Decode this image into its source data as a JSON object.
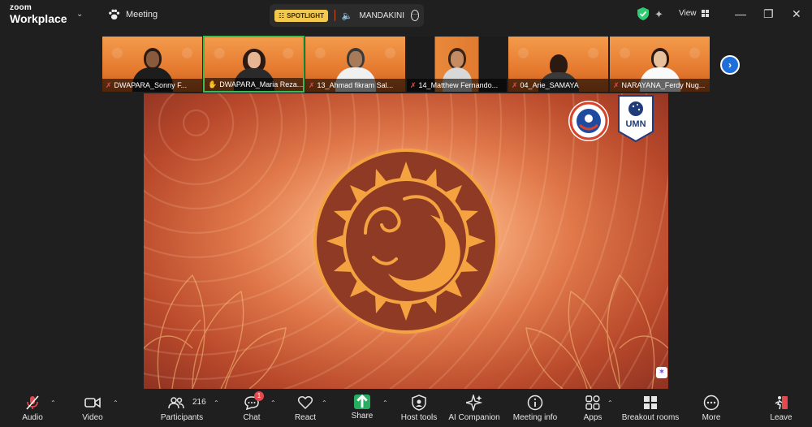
{
  "app": {
    "brand_line1": "zoom",
    "brand_line2": "Workplace",
    "meeting_tab": "Meeting"
  },
  "spotlight": {
    "badge": "SPOTLIGHT",
    "name": "MANDAKINI"
  },
  "view_label": "View",
  "participants_strip": [
    {
      "name": "DWAPARA_Sonny F..."
    },
    {
      "name": "DWAPARA_Maria Reza..."
    },
    {
      "name": "13_Ahmad fikram Sal..."
    },
    {
      "name": "14_Matthew Fernando..."
    },
    {
      "name": "04_Arie_SAMAYA"
    },
    {
      "name": "NARAYANA_Ferdy Nug..."
    }
  ],
  "main_screen": {
    "logo_right_text": "UMN"
  },
  "toolbar": {
    "audio": "Audio",
    "video": "Video",
    "participants": "Participants",
    "participants_count": "216",
    "chat": "Chat",
    "chat_badge": "1",
    "react": "React",
    "share": "Share",
    "host_tools": "Host tools",
    "ai_companion": "AI Companion",
    "meeting_info": "Meeting info",
    "apps": "Apps",
    "breakout_rooms": "Breakout rooms",
    "more": "More",
    "leave": "Leave"
  },
  "colors": {
    "active_border": "#3cba54",
    "spotlight_badge": "#f2c94c",
    "share_green": "#27ae60",
    "muted_red": "#e5484d",
    "next_blue": "#1e6fd9"
  }
}
